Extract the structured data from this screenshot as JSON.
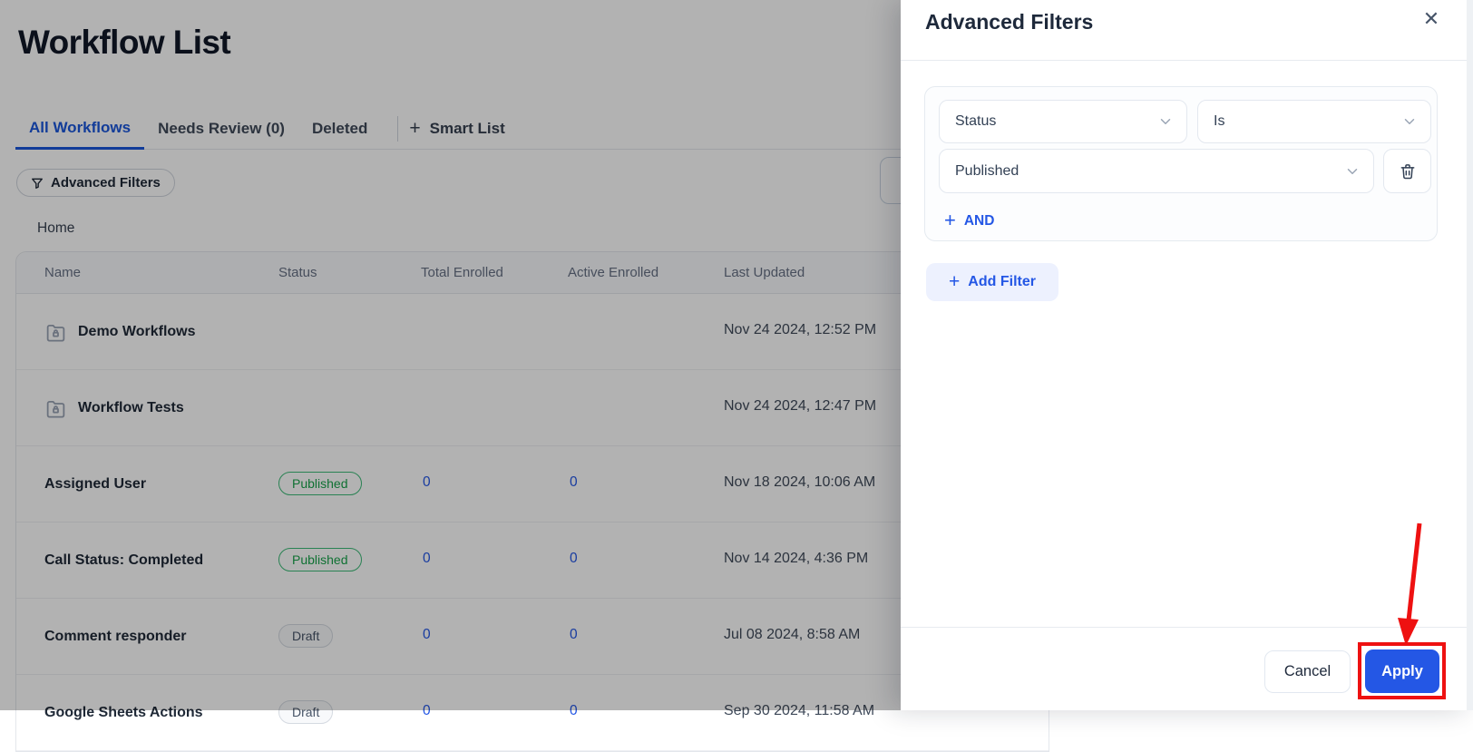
{
  "page": {
    "title": "Workflow List",
    "tabs": [
      {
        "label": "All Workflows"
      },
      {
        "label": "Needs Review (0)"
      },
      {
        "label": "Deleted"
      }
    ],
    "smart_list_label": "Smart List",
    "advanced_filters_button": "Advanced Filters",
    "breadcrumb": "Home",
    "table": {
      "headers": [
        "Name",
        "Status",
        "Total Enrolled",
        "Active Enrolled",
        "Last Updated"
      ],
      "rows": [
        {
          "name": "Demo Workflows",
          "type": "folder",
          "last_updated": "Nov 24 2024, 12:52 PM"
        },
        {
          "name": "Workflow Tests",
          "type": "folder",
          "last_updated": "Nov 24 2024, 12:47 PM"
        },
        {
          "name": "Assigned User",
          "type": "workflow",
          "status": "Published",
          "total_enrolled": "0",
          "active_enrolled": "0",
          "last_updated": "Nov 18 2024, 10:06 AM"
        },
        {
          "name": "Call Status: Completed",
          "type": "workflow",
          "status": "Published",
          "total_enrolled": "0",
          "active_enrolled": "0",
          "last_updated": "Nov 14 2024, 4:36 PM"
        },
        {
          "name": "Comment responder",
          "type": "workflow",
          "status": "Draft",
          "total_enrolled": "0",
          "active_enrolled": "0",
          "last_updated": "Jul 08 2024, 8:58 AM"
        },
        {
          "name": "Google Sheets Actions",
          "type": "workflow",
          "status": "Draft",
          "total_enrolled": "0",
          "active_enrolled": "0",
          "last_updated": "Sep 30 2024, 11:58 AM"
        }
      ]
    }
  },
  "panel": {
    "title": "Advanced Filters",
    "close_icon": "✕",
    "filter": {
      "field": "Status",
      "operator": "Is",
      "value": "Published",
      "and_label": "AND"
    },
    "add_filter_label": "Add Filter",
    "footer": {
      "cancel_label": "Cancel",
      "apply_label": "Apply"
    }
  },
  "colors": {
    "accent_blue": "#2457e5",
    "tab_active_blue": "#1a56db",
    "status_published_green": "#17a34a",
    "annotation_red": "#ee1111"
  }
}
